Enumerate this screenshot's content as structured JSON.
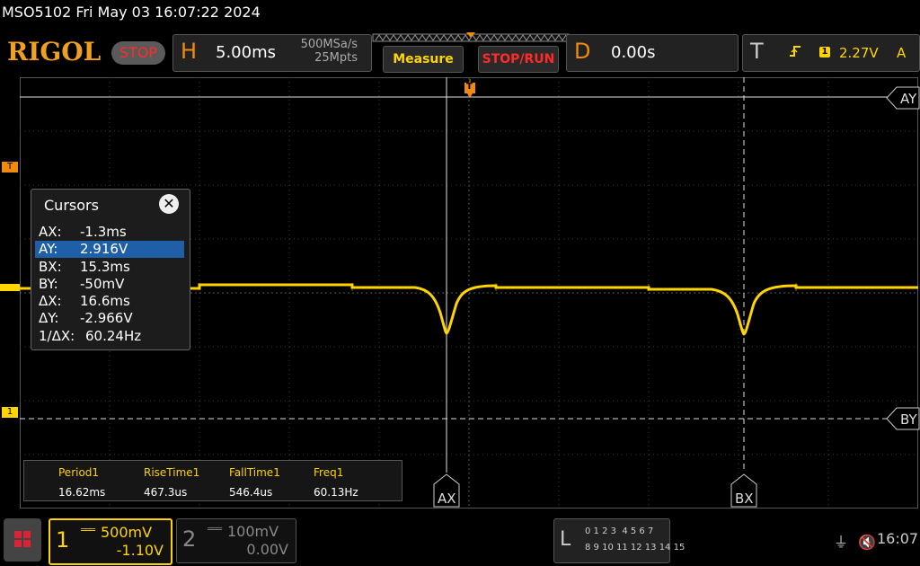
{
  "header": {
    "title": "MSO5102  Fri May 03 16:07:22 2024",
    "logo": "RIGOL",
    "run_state": "STOP"
  },
  "horizontal": {
    "letter": "H",
    "timebase": "5.00ms",
    "sample_rate": "500MSa/s",
    "memory_depth": "25Mpts"
  },
  "buttons": {
    "measure": "Measure",
    "stop_run": "STOP/RUN"
  },
  "delay": {
    "letter": "D",
    "value": "0.00s"
  },
  "trigger": {
    "letter": "T",
    "source": "1",
    "level": "2.27V",
    "mode": "A",
    "marker": "T"
  },
  "channel_marker": "1",
  "cursor_labels": {
    "ay": "AY",
    "by": "BY",
    "ax": "AX",
    "bx": "BX"
  },
  "cursors_panel": {
    "title": "Cursors",
    "rows": [
      {
        "label": "AX:",
        "value": "-1.3ms"
      },
      {
        "label": "AY:",
        "value": "2.916V"
      },
      {
        "label": "BX:",
        "value": "15.3ms"
      },
      {
        "label": "BY:",
        "value": "-50mV"
      },
      {
        "label": "ΔX:",
        "value": "16.6ms"
      },
      {
        "label": "ΔY:",
        "value": "-2.966V"
      },
      {
        "label": "1/ΔX:",
        "value": "60.24Hz"
      }
    ],
    "selected_index": 1
  },
  "measurements": [
    {
      "name": "Period1",
      "value": "16.62ms"
    },
    {
      "name": "RiseTime1",
      "value": "467.3us"
    },
    {
      "name": "FallTime1",
      "value": "546.4us"
    },
    {
      "name": "Freq1",
      "value": "60.13Hz"
    }
  ],
  "channels": [
    {
      "num": "1",
      "scale": "500mV",
      "offset": "-1.10V",
      "color": "#ffd400"
    },
    {
      "num": "2",
      "scale": "100mV",
      "offset": "0.00V",
      "color": "#888888"
    }
  ],
  "logic": {
    "letter": "L",
    "row1": "0 1 2 3  4 5 6 7",
    "row2": "8 9 10 11 12 13 14 15"
  },
  "status": {
    "clock": "16:07"
  },
  "colors": {
    "ch1": "#ffd400",
    "accent_orange": "#f08a10",
    "stop_red": "#ff2a2a",
    "cursor_selected": "#1f5fa8"
  }
}
